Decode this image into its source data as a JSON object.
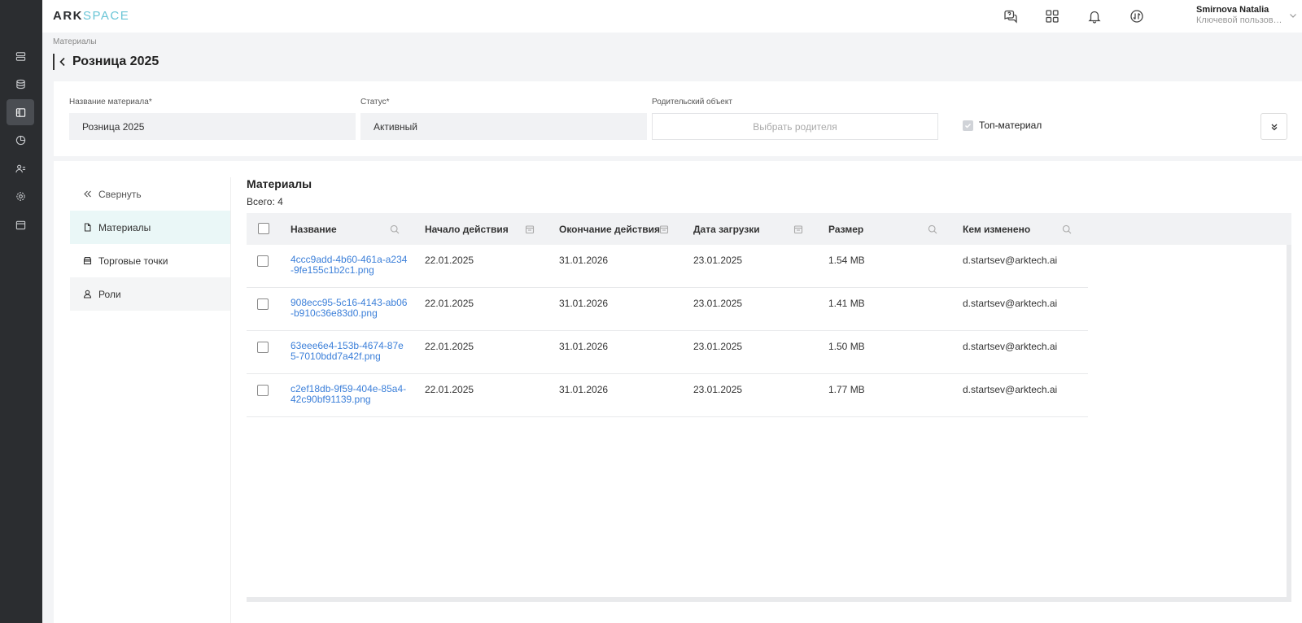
{
  "app": {
    "logo_a": "ARK",
    "logo_b": "SPACE"
  },
  "header": {
    "user_name": "Smirnova Natalia",
    "user_role": "Ключевой пользователь"
  },
  "breadcrumb": "Материалы",
  "page_title": "Розница 2025",
  "form": {
    "name_label": "Название материала*",
    "name_value": "Розница 2025",
    "status_label": "Статус*",
    "status_value": "Активный",
    "parent_label": "Родительский объект",
    "parent_placeholder": "Выбрать родителя",
    "top_label": "Топ-материал",
    "top_checked": true
  },
  "side_nav": {
    "collapse": "Свернуть",
    "items": [
      {
        "label": "Материалы",
        "icon": "file-icon"
      },
      {
        "label": "Торговые точки",
        "icon": "store-icon"
      },
      {
        "label": "Роли",
        "icon": "user-icon"
      }
    ]
  },
  "materials": {
    "title": "Материалы",
    "total": "Всего: 4",
    "columns": [
      "Название",
      "Начало действия",
      "Окончание действия",
      "Дата загрузки",
      "Размер",
      "Кем изменено"
    ],
    "rows": [
      {
        "name": "4ccc9add-4b60-461a-a234-9fe155c1b2c1.png",
        "start": "22.01.2025",
        "end": "31.01.2026",
        "uploaded": "23.01.2025",
        "size": "1.54 MB",
        "by": "d.startsev@arktech.ai"
      },
      {
        "name": "908ecc95-5c16-4143-ab06-b910c36e83d0.png",
        "start": "22.01.2025",
        "end": "31.01.2026",
        "uploaded": "23.01.2025",
        "size": "1.41 MB",
        "by": "d.startsev@arktech.ai"
      },
      {
        "name": "63eee6e4-153b-4674-87e5-7010bdd7a42f.png",
        "start": "22.01.2025",
        "end": "31.01.2026",
        "uploaded": "23.01.2025",
        "size": "1.50 MB",
        "by": "d.startsev@arktech.ai"
      },
      {
        "name": "c2ef18db-9f59-404e-85a4-42c90bf91139.png",
        "start": "22.01.2025",
        "end": "31.01.2026",
        "uploaded": "23.01.2025",
        "size": "1.77 MB",
        "by": "d.startsev@arktech.ai"
      }
    ]
  },
  "colors": {
    "rail_bg": "#2b2d30",
    "accent": "#69c5d6",
    "link": "#3b7fd9",
    "active_nav": "#eaf7f7"
  }
}
